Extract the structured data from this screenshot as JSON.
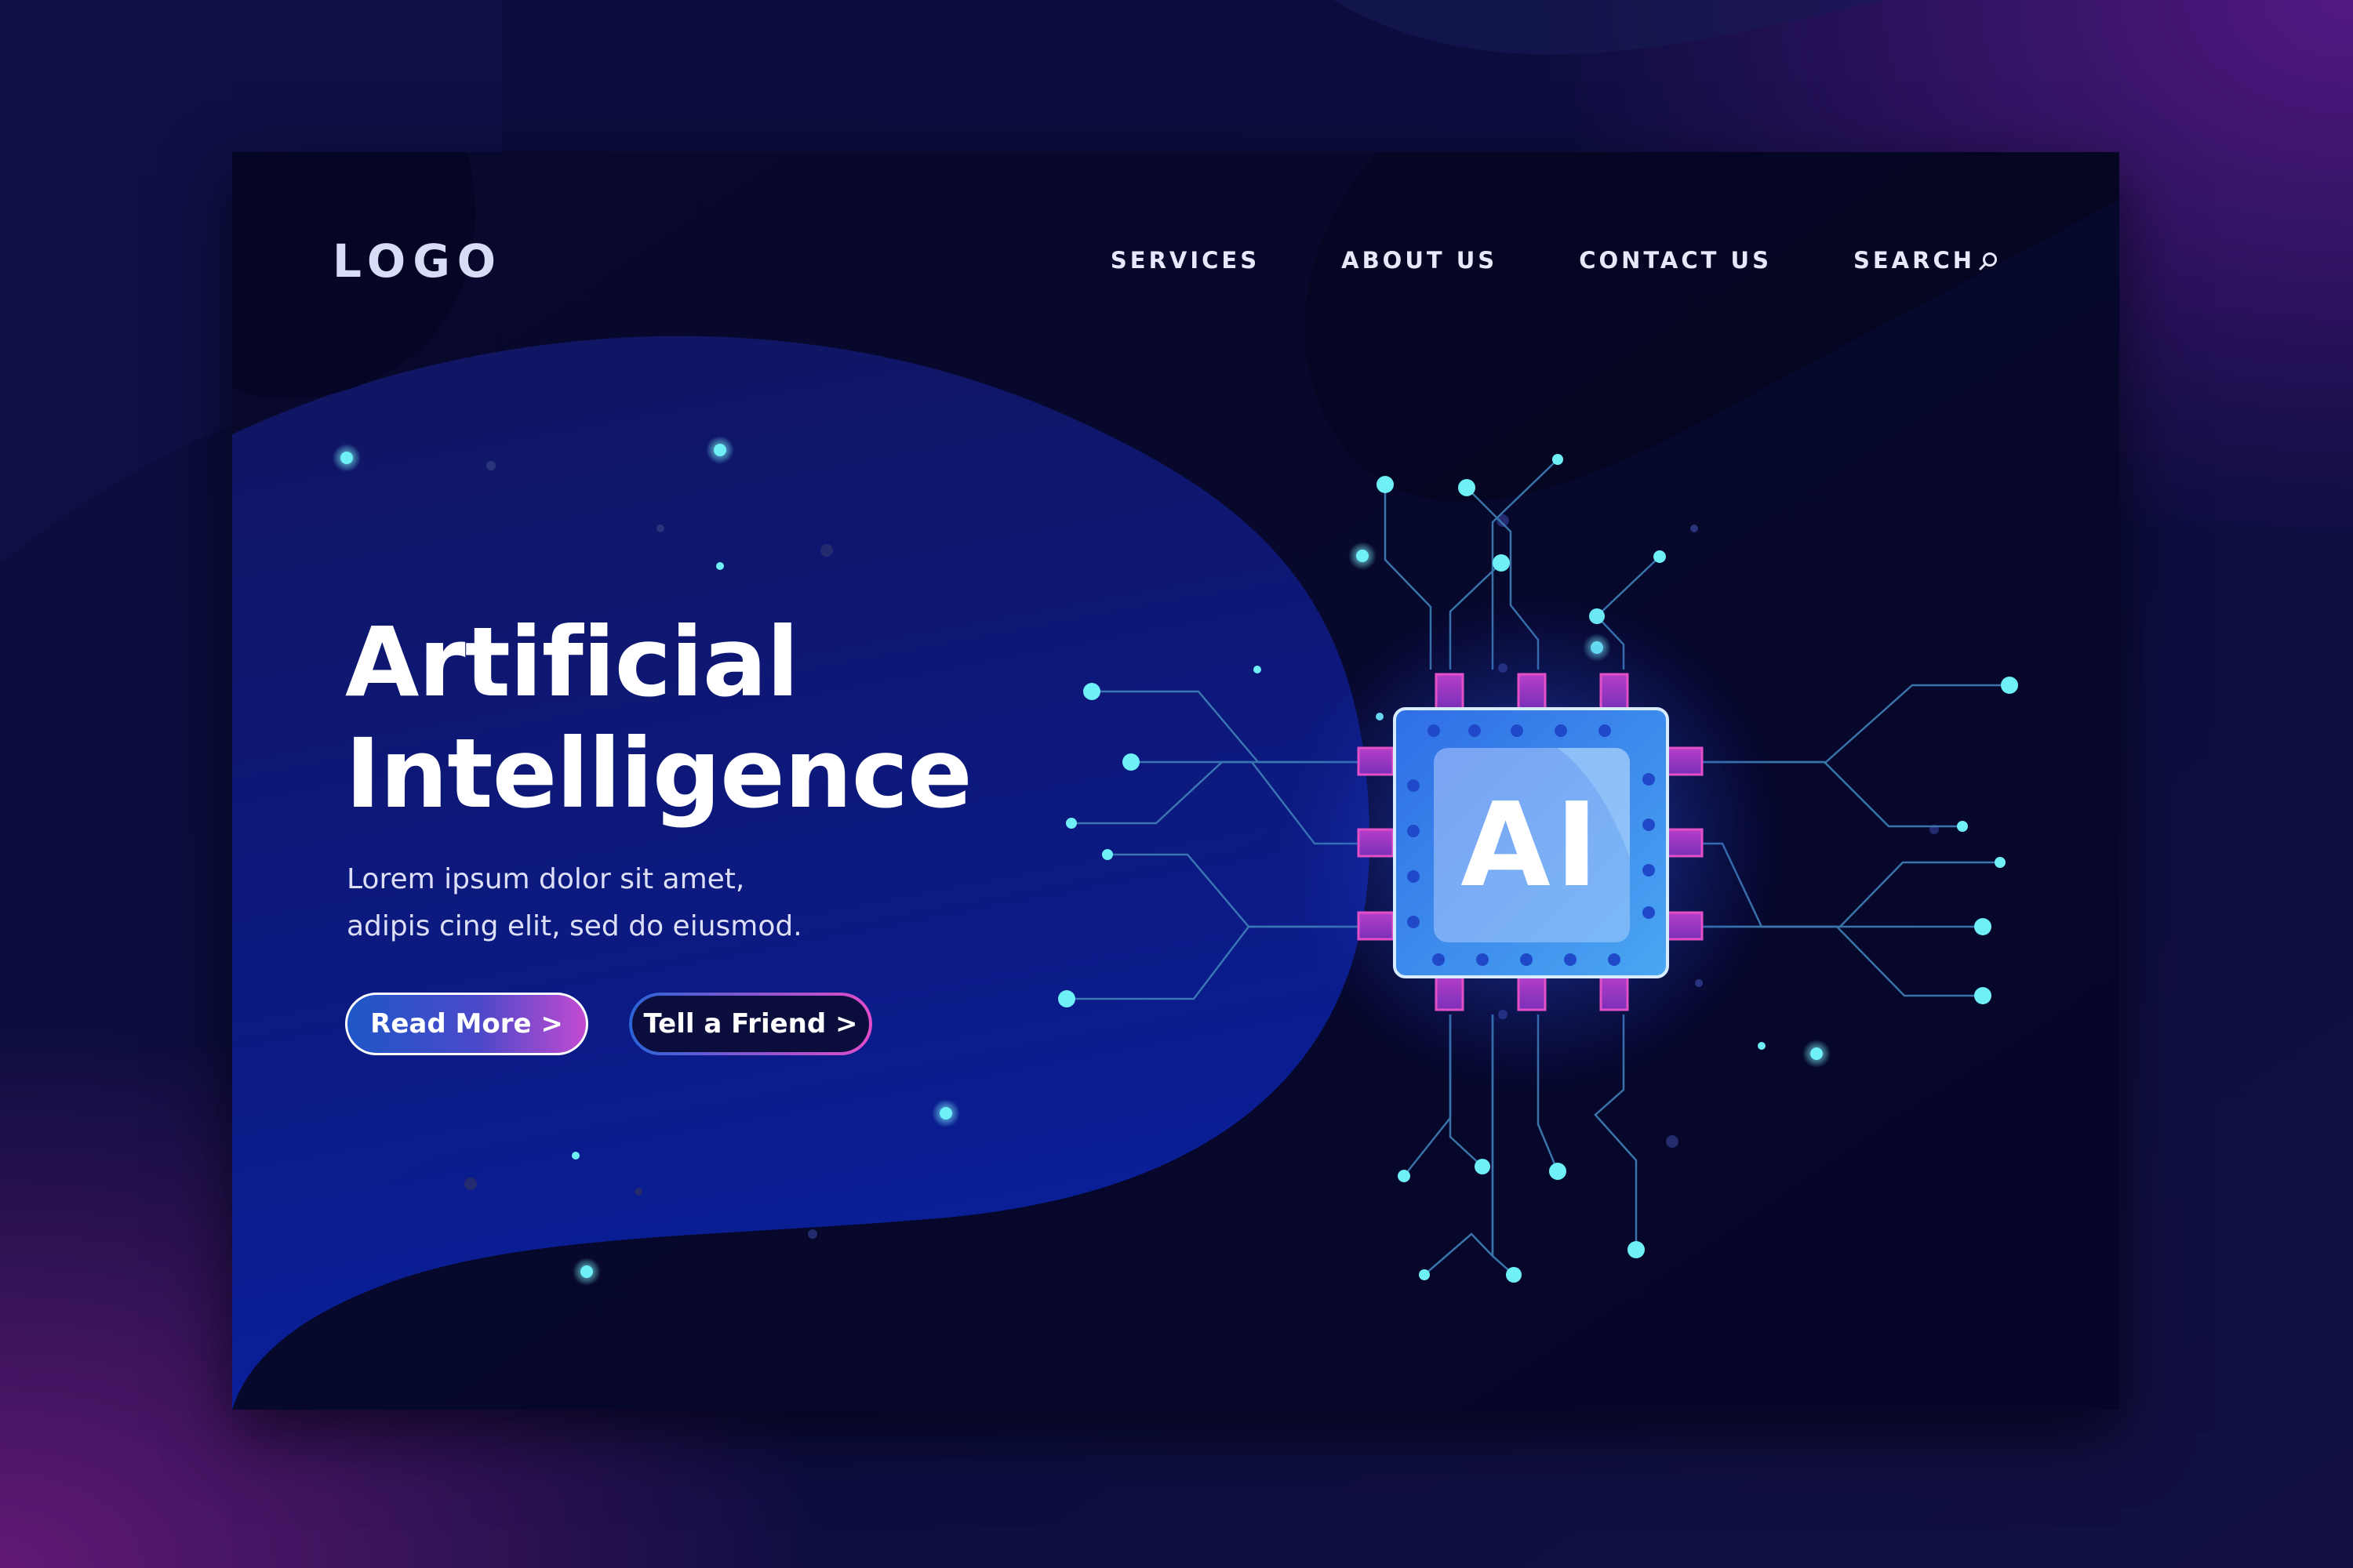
{
  "header": {
    "logo": "LOGO",
    "nav": [
      {
        "label": "SERVICES"
      },
      {
        "label": "ABOUT US"
      },
      {
        "label": "CONTACT US"
      },
      {
        "label": "SEARCH",
        "icon": "search-icon"
      }
    ]
  },
  "hero": {
    "title_line1": "Artificial",
    "title_line2": "Intelligence",
    "subtitle_line1": "Lorem ipsum dolor sit amet,",
    "subtitle_line2": "adipis cing elit, sed do eiusmod.",
    "primary_button": "Read More >",
    "secondary_button": "Tell a Friend >"
  },
  "chip": {
    "label": "AI",
    "icon": "ai-chip-icon"
  },
  "colors": {
    "background": "#0a0c3a",
    "card": "#06072a",
    "accent_cyan": "#5ce8f0",
    "accent_blue": "#2f6ee0",
    "accent_magenta": "#d23fc8"
  }
}
